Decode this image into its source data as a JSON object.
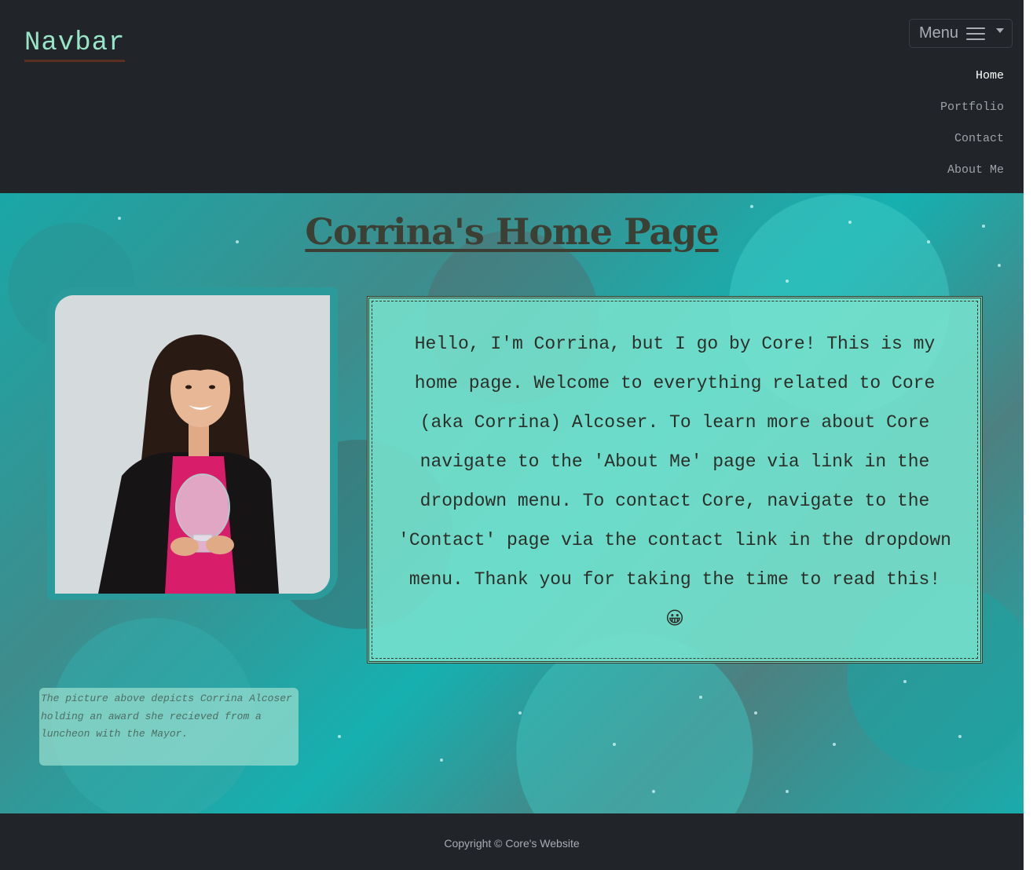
{
  "navbar": {
    "brand": "Navbar",
    "menu_label": "Menu",
    "menu_icon": "hamburger-icon",
    "links": [
      {
        "label": "Home",
        "active": true
      },
      {
        "label": "Portfolio",
        "active": false
      },
      {
        "label": "Contact",
        "active": false
      },
      {
        "label": "About Me",
        "active": false
      }
    ]
  },
  "main": {
    "title": "Corrina's Home Page",
    "intro": "Hello, I'm Corrina, but I go by Core! This is my home page. Welcome to everything related to Core (aka Corrina) Alcoser. To learn more about Core navigate to the 'About Me' page via link in the dropdown menu. To contact Core, navigate to the 'Contact' page via the contact link in the dropdown menu. Thank you for taking the time to read this!",
    "intro_emoji": "😀",
    "caption": "The picture above depicts Corrina Alcoser holding an award she recieved from a luncheon with the Mayor."
  },
  "footer": {
    "copyright": "Copyright © Core's Website"
  },
  "colors": {
    "nav_bg": "#212429",
    "brand": "#98e4c7",
    "intro_bg": "#78e1cd",
    "title": "#3c3f33"
  }
}
